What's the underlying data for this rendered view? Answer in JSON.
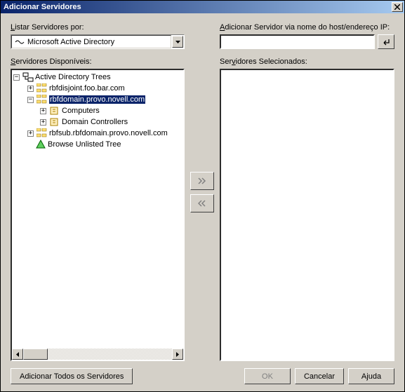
{
  "title": "Adicionar Servidores",
  "left": {
    "list_by_label": "Listar Servidores por:",
    "directory_value": "Microsoft Active Directory",
    "available_label": "Servidores Disponíveis:",
    "tree": {
      "root": "Active Directory Trees",
      "n1": "rbfdisjoint.foo.bar.com",
      "n2": "rbfdomain.provo.novell.com",
      "n2a": "Computers",
      "n2b": "Domain Controllers",
      "n3": "rbfsub.rbfdomain.provo.novell.com",
      "n4": "Browse Unlisted Tree"
    },
    "add_all_label": "Adicionar Todos os Servidores"
  },
  "right": {
    "add_host_label": "Adicionar Servidor via nome do host/endereço IP:",
    "host_value": "",
    "selected_label": "Servidores Selecionados:"
  },
  "buttons": {
    "ok": "OK",
    "cancel": "Cancelar",
    "help": "Ajuda"
  }
}
